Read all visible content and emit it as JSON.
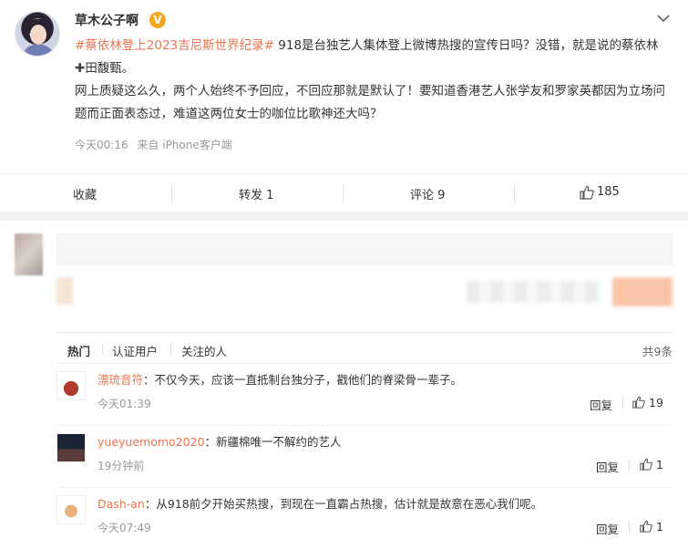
{
  "post": {
    "username": "草木公子啊",
    "vip_badge": "V",
    "tag": "#蔡依林登上2023吉尼斯世界纪录#",
    "text_1": " 918是台独艺人集体登上微博热搜的宣传日吗？没错，就是说的蔡依林",
    "cross": "✚",
    "text_2": "田馥甄。",
    "text_3": "网上质疑这么久，两个人始终不予回应，不回应那就是默认了！要知道香港艺人张学友和罗家英都因为立场问题而正面表态过，难道这两位女士的咖位比歌神还大吗？",
    "time": "今天00:16",
    "source": "来自 iPhone客户端"
  },
  "actions": {
    "favorite": "收藏",
    "repost": "转发 1",
    "comment": "评论 9",
    "like": "185"
  },
  "comment_tabs": {
    "hot": "热门",
    "verified": "认证用户",
    "following": "关注的人",
    "total": "共9条"
  },
  "comments": [
    {
      "name": "漂琉音符",
      "text": "：不仅今天，应该一直抵制台独分子，戳他们的脊梁骨一辈子。",
      "time": "今天01:39",
      "reply": "回复",
      "likes": "19"
    },
    {
      "name": "yueyuemomo2020",
      "text": "：新疆棉唯一不解约的艺人",
      "time": "19分钟前",
      "reply": "回复",
      "likes": "1"
    },
    {
      "name": "Dash-an",
      "text": "：从918前夕开始买热搜，到现在一直霸占热搜，估计就是故意在恶心我们呢。",
      "time": "今天07:49",
      "reply": "回复",
      "likes": "1"
    }
  ],
  "colors": {
    "accent": "#eb7350",
    "vip": "#f5a623",
    "muted": "#999999"
  }
}
